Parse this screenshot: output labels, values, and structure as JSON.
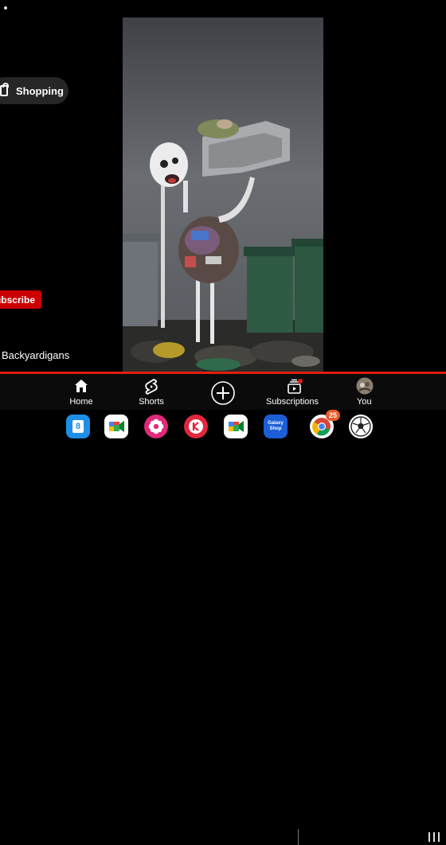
{
  "overlay": {
    "shopping_label": "Shopping",
    "subscribe_label": "Subscribe",
    "channel_name": "Backyardigans"
  },
  "bottom_nav": {
    "items": [
      {
        "label": "Home",
        "icon": "home-icon"
      },
      {
        "label": "Shorts",
        "icon": "shorts-icon"
      },
      {
        "label": "",
        "icon": "create-icon"
      },
      {
        "label": "Subscriptions",
        "icon": "subscriptions-icon"
      },
      {
        "label": "You",
        "icon": "avatar"
      }
    ]
  },
  "dock": {
    "apps": [
      {
        "name": "calendar-app",
        "text": "8"
      },
      {
        "name": "meet-app",
        "text": ""
      },
      {
        "name": "gallery-app",
        "text": ""
      },
      {
        "name": "kinemaster-app",
        "text": ""
      },
      {
        "name": "meet-app-2",
        "text": ""
      },
      {
        "name": "galaxy-shop-app",
        "text": "Galaxy Shop"
      },
      {
        "name": "chrome-app",
        "text": ""
      },
      {
        "name": "soccer-app",
        "text": ""
      }
    ],
    "chrome_badge": "25"
  },
  "colors": {
    "accent_red": "#cc0000",
    "progress_red": "#e0200f",
    "nav_bg": "#0b0b0b"
  }
}
